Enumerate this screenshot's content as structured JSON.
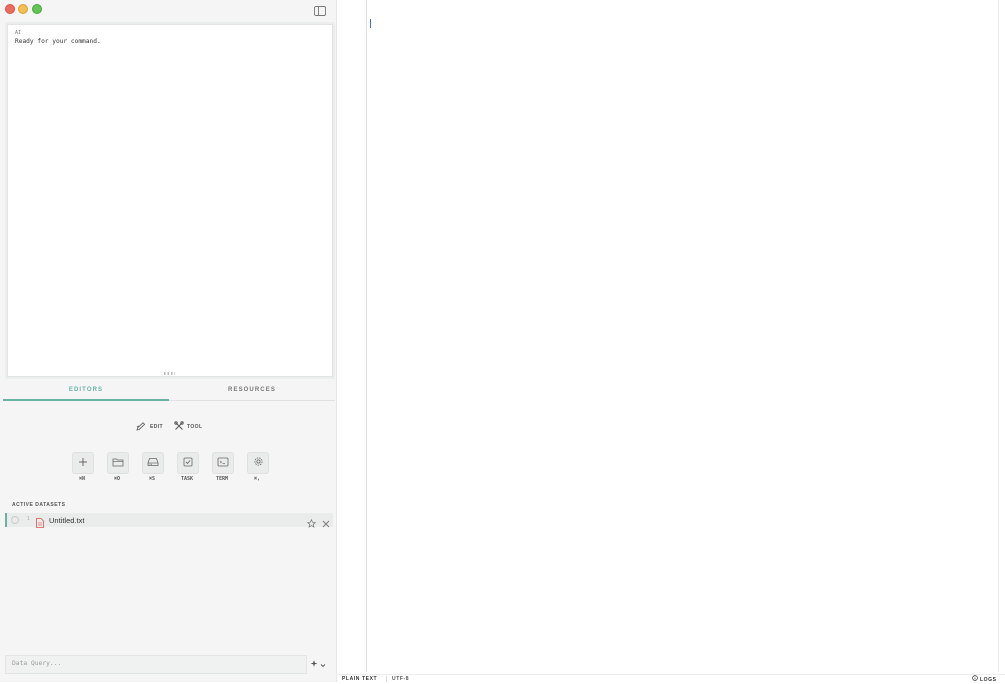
{
  "console": {
    "label": "AI",
    "output": "Ready for your command."
  },
  "tabs": {
    "editors": "EDITORS",
    "resources": "RESOURCES"
  },
  "modes": {
    "edit": "EDIT",
    "tool": "TOOL"
  },
  "actions": [
    {
      "label": "⌘N",
      "icon": "plus-icon"
    },
    {
      "label": "⌘O",
      "icon": "folder-icon"
    },
    {
      "label": "⌘S",
      "icon": "drive-icon"
    },
    {
      "label": "TASK",
      "icon": "checkbox-icon"
    },
    {
      "label": "TERM",
      "icon": "terminal-icon"
    },
    {
      "label": "⌘,",
      "icon": "gear-icon"
    }
  ],
  "datasets": {
    "header": "ACTIVE DATASETS",
    "items": [
      {
        "index": "1",
        "name": "Untitled.txt"
      }
    ]
  },
  "query": {
    "placeholder": "Data Query..."
  },
  "status": {
    "language": "PLAIN TEXT",
    "encoding": "UTF-8",
    "logs": "LOGS"
  },
  "colors": {
    "accent": "#6ab2a2",
    "caret": "#3f6ddb",
    "file_icon": "#d9534f"
  }
}
